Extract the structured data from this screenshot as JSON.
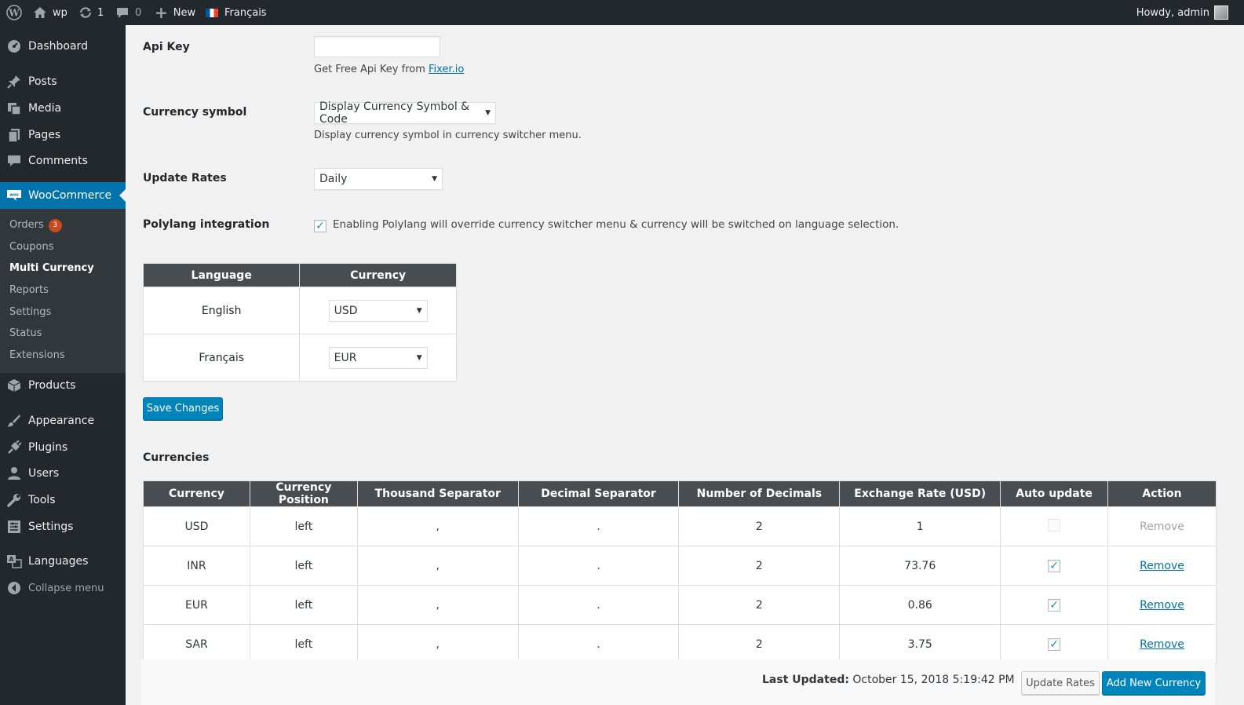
{
  "adminbar": {
    "site_name": "wp",
    "updates_count": "1",
    "comments_count": "0",
    "new_label": "New",
    "language": "Français",
    "howdy": "Howdy, admin"
  },
  "sidebar": {
    "items": [
      {
        "label": "Dashboard",
        "icon": "dashboard-icon"
      },
      {
        "label": "Posts",
        "icon": "pin-icon"
      },
      {
        "label": "Media",
        "icon": "media-icon"
      },
      {
        "label": "Pages",
        "icon": "pages-icon"
      },
      {
        "label": "Comments",
        "icon": "comment-icon"
      },
      {
        "label": "WooCommerce",
        "icon": "woo-icon"
      },
      {
        "label": "Products",
        "icon": "box-icon"
      },
      {
        "label": "Appearance",
        "icon": "brush-icon"
      },
      {
        "label": "Plugins",
        "icon": "plug-icon"
      },
      {
        "label": "Users",
        "icon": "user-icon"
      },
      {
        "label": "Tools",
        "icon": "wrench-icon"
      },
      {
        "label": "Settings",
        "icon": "settings-icon"
      },
      {
        "label": "Languages",
        "icon": "translate-icon"
      }
    ],
    "woo_submenu": [
      {
        "label": "Orders",
        "badge": "3"
      },
      {
        "label": "Coupons"
      },
      {
        "label": "Multi Currency"
      },
      {
        "label": "Reports"
      },
      {
        "label": "Settings"
      },
      {
        "label": "Status"
      },
      {
        "label": "Extensions"
      }
    ],
    "collapse_label": "Collapse menu"
  },
  "form": {
    "api_key_label": "Api Key",
    "api_key_value": "",
    "api_key_desc_prefix": "Get Free Api Key from ",
    "api_key_link": "Fixer.io",
    "currency_symbol_label": "Currency symbol",
    "currency_symbol_value": "Display Currency Symbol & Code",
    "currency_symbol_desc": "Display currency symbol in currency switcher menu.",
    "update_rates_label": "Update Rates",
    "update_rates_value": "Daily",
    "polylang_label": "Polylang integration",
    "polylang_checked": true,
    "polylang_desc": "Enabling Polylang will override currency switcher menu & currency will be switched on language selection."
  },
  "lang_table": {
    "headers": [
      "Language",
      "Currency"
    ],
    "rows": [
      {
        "language": "English",
        "currency": "USD"
      },
      {
        "language": "Français",
        "currency": "EUR"
      }
    ]
  },
  "save_button": "Save Changes",
  "currencies": {
    "title": "Currencies",
    "headers": [
      "Currency",
      "Currency Position",
      "Thousand Separator",
      "Decimal Separator",
      "Number of Decimals",
      "Exchange Rate (USD)",
      "Auto update",
      "Action"
    ],
    "rows": [
      {
        "currency": "USD",
        "position": "left",
        "thousand": ",",
        "decimal": ".",
        "decimals": "2",
        "rate": "1",
        "auto": false,
        "auto_disabled": true,
        "action": "Remove",
        "action_disabled": true
      },
      {
        "currency": "INR",
        "position": "left",
        "thousand": ",",
        "decimal": ".",
        "decimals": "2",
        "rate": "73.76",
        "auto": true,
        "auto_disabled": false,
        "action": "Remove",
        "action_disabled": false
      },
      {
        "currency": "EUR",
        "position": "left",
        "thousand": ",",
        "decimal": ".",
        "decimals": "2",
        "rate": "0.86",
        "auto": true,
        "auto_disabled": false,
        "action": "Remove",
        "action_disabled": false
      },
      {
        "currency": "SAR",
        "position": "left",
        "thousand": ",",
        "decimal": ".",
        "decimals": "2",
        "rate": "3.75",
        "auto": true,
        "auto_disabled": false,
        "action": "Remove",
        "action_disabled": false
      }
    ],
    "last_updated_label": "Last Updated:",
    "last_updated_value": "October 15, 2018 5:19:42 PM",
    "update_rates_button": "Update Rates",
    "add_new_button": "Add New Currency"
  },
  "colors": {
    "adminbar_bg": "#23282d",
    "sidebar_active": "#0073aa",
    "table_header": "#484d51",
    "primary_button": "#0085ba",
    "badge": "#ca4a1f"
  }
}
